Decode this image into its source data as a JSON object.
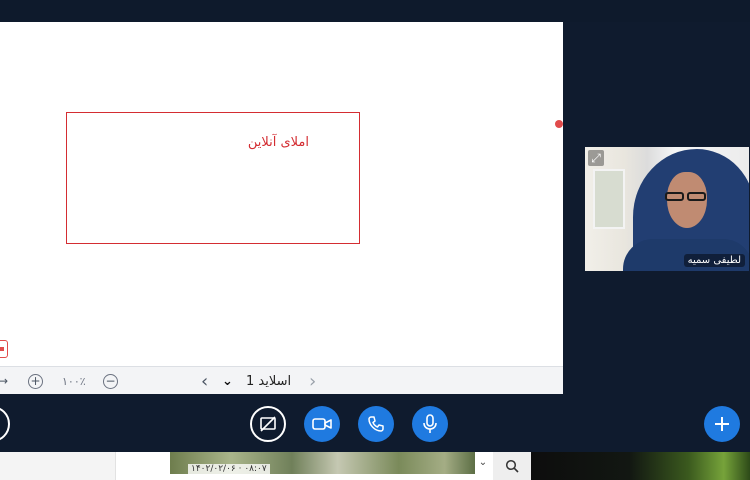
{
  "presentation": {
    "slide_text": "املای آنلاین",
    "toolbar": {
      "slide_label": "اسلاید 1",
      "zoom_value": "۱۰۰٪",
      "arrow_glyph": "→",
      "zoom_in_glyph": "+",
      "zoom_out_glyph": "−",
      "prev_glyph": "‹",
      "next_glyph": "‹",
      "dropdown_glyph": "⌄"
    }
  },
  "participant": {
    "name": "لطیفی سمیه",
    "expand_glyph": "⤢"
  },
  "controls": {
    "accent_color": "#1f7ae0",
    "buttons": [
      "screen-share-off",
      "camera",
      "phone",
      "microphone",
      "add"
    ]
  },
  "os_strip": {
    "thumb_caption": "۱۴۰۲/۰۲/۰۶ · ۰۸:۰۷",
    "dropdown_glyph": "⌄",
    "search_glyph": "🔍"
  }
}
